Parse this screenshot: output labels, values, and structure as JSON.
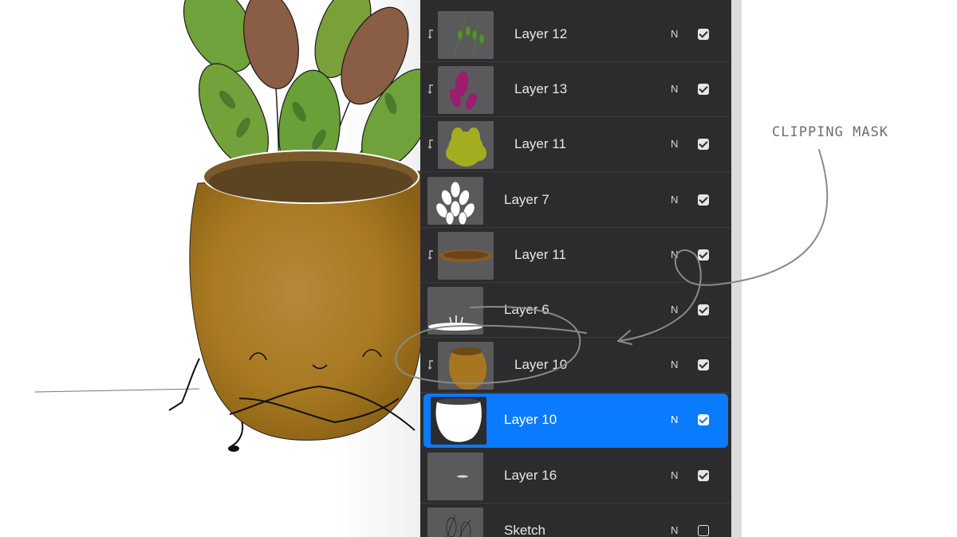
{
  "annotation": {
    "label": "CLIPPING MASK"
  },
  "layers": [
    {
      "name": "Layer 12",
      "blend": "N",
      "visible": true,
      "clipped": true,
      "selected": false,
      "thumb": "ferns"
    },
    {
      "name": "Layer 13",
      "blend": "N",
      "visible": true,
      "clipped": true,
      "selected": false,
      "thumb": "purple-leaves"
    },
    {
      "name": "Layer 11",
      "blend": "N",
      "visible": true,
      "clipped": true,
      "selected": false,
      "thumb": "green-leaves"
    },
    {
      "name": "Layer 7",
      "blend": "N",
      "visible": true,
      "clipped": false,
      "selected": false,
      "thumb": "white-leaves"
    },
    {
      "name": "Layer 11",
      "blend": "N",
      "visible": true,
      "clipped": true,
      "selected": false,
      "thumb": "pot-rim"
    },
    {
      "name": "Layer 6",
      "blend": "N",
      "visible": true,
      "clipped": false,
      "selected": false,
      "thumb": "white-rim"
    },
    {
      "name": "Layer 10",
      "blend": "N",
      "visible": true,
      "clipped": true,
      "selected": false,
      "thumb": "pot-texture"
    },
    {
      "name": "Layer 10",
      "blend": "N",
      "visible": true,
      "clipped": false,
      "selected": true,
      "thumb": "white-pot"
    },
    {
      "name": "Layer 16",
      "blend": "N",
      "visible": true,
      "clipped": false,
      "selected": false,
      "thumb": "small-stroke"
    },
    {
      "name": "Sketch",
      "blend": "N",
      "visible": false,
      "clipped": false,
      "selected": false,
      "thumb": "sketch"
    }
  ],
  "colors": {
    "selected": "#0a7aff",
    "panel": "#2c2c2e",
    "pot": "#b08325"
  }
}
